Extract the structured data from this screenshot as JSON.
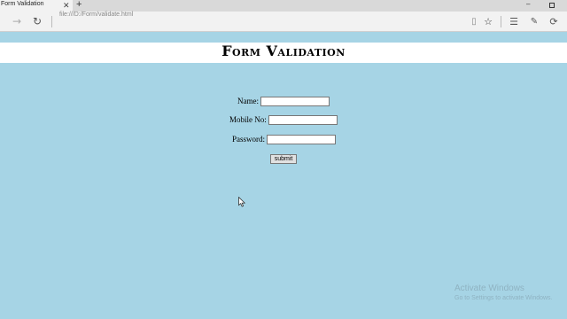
{
  "browser": {
    "tab_title": "Form Validation",
    "tab_close": "✕",
    "new_tab": "+",
    "address": "file:///D:/Form/validate.html",
    "minimize": "–"
  },
  "page": {
    "title": "Form Validation",
    "fields": [
      {
        "label": "Name:",
        "value": ""
      },
      {
        "label": "Mobile No:",
        "value": ""
      },
      {
        "label": "Password:",
        "value": ""
      }
    ],
    "submit_label": "submit"
  },
  "watermark": {
    "title": "Activate Windows",
    "subtitle": "Go to Settings to activate Windows."
  },
  "colors": {
    "page_background": "#a6d4e5",
    "title_band": "#ffffff"
  }
}
